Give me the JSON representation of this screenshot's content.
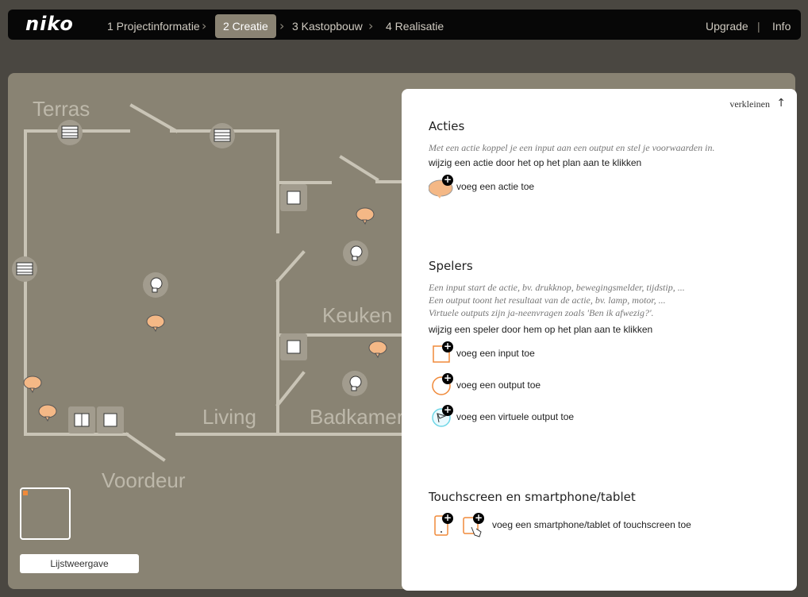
{
  "app": {
    "logo": "niko"
  },
  "nav": {
    "steps": [
      {
        "label": "1 Projectinformatie"
      },
      {
        "label": "2 Creatie"
      },
      {
        "label": "3 Kastopbouw"
      },
      {
        "label": "4 Realisatie"
      }
    ],
    "right": {
      "upgrade": "Upgrade",
      "separator": "|",
      "info": "Info"
    }
  },
  "plan": {
    "rooms": {
      "terras": "Terras",
      "keuken": "Keuken",
      "living": "Living",
      "badkamer": "Badkamer",
      "voordeur": "Voordeur"
    },
    "list_view_button": "Lijstweergave"
  },
  "panel": {
    "collapse_label": "verkleinen",
    "acties": {
      "title": "Acties",
      "description": "Met een actie koppel je een input aan een output en stel je voorwaarden in.",
      "instruction": "wijzig een actie door het op het plan aan te klikken",
      "add_action": "voeg een actie toe"
    },
    "spelers": {
      "title": "Spelers",
      "desc_input": "Een input start de actie, bv. drukknop, bewegingsmelder, tijdstip, ...",
      "desc_output": "Een output toont het resultaat van de actie, bv. lamp, motor, ...",
      "desc_virtual": "Virtuele outputs zijn ja-neenvragen zoals 'Ben ik afwezig?'.",
      "instruction": "wijzig een speler door hem op het plan aan te klikken",
      "add_input": "voeg een input toe",
      "add_output": "voeg een output toe",
      "add_virtual": "voeg een virtuele output toe"
    },
    "touchscreen": {
      "title": "Touchscreen en smartphone/tablet",
      "add_device": "voeg een smartphone/tablet of touchscreen toe"
    }
  },
  "colors": {
    "topbar_bg": "#070707",
    "active_step_bg": "#8a8373",
    "plan_bg": "#898373",
    "wall": "#c9c4b6",
    "accent_orange": "#f08a3a",
    "bubble": "#f4b886",
    "virtual_cyan": "#6fd6e6"
  }
}
